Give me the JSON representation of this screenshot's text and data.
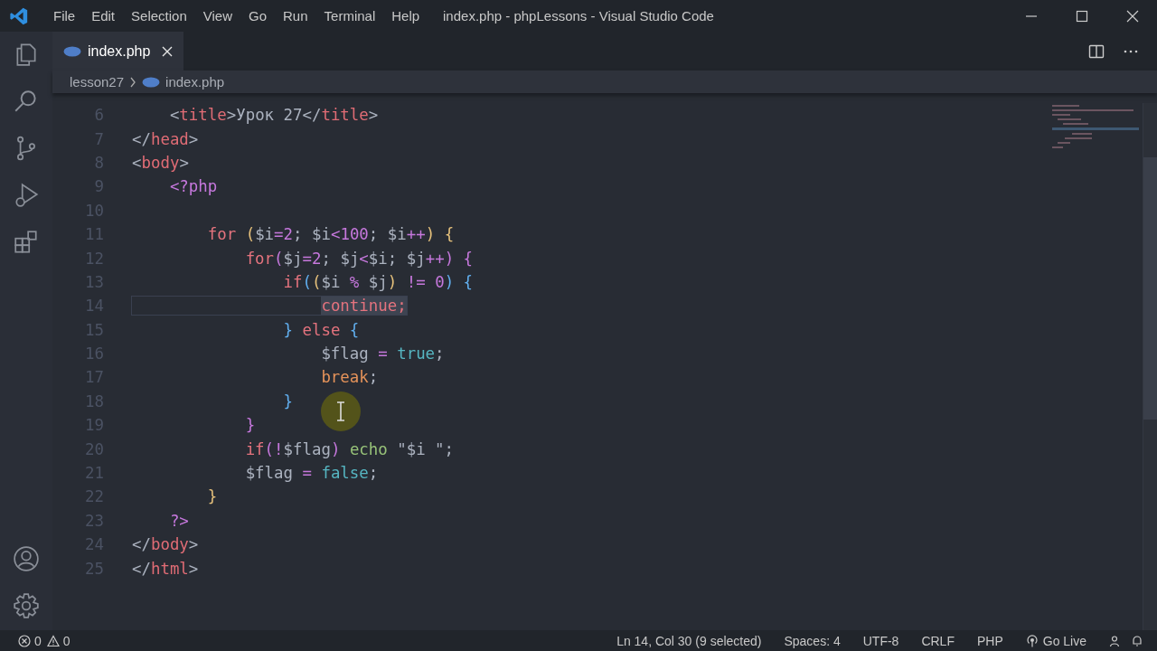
{
  "window": {
    "title": "index.php - phpLessons - Visual Studio Code"
  },
  "menu": [
    "File",
    "Edit",
    "Selection",
    "View",
    "Go",
    "Run",
    "Terminal",
    "Help"
  ],
  "activity_bar": [
    {
      "kind": "explorer",
      "selected": false
    },
    {
      "kind": "search",
      "selected": false
    },
    {
      "kind": "source-control",
      "selected": false
    },
    {
      "kind": "debug",
      "selected": false
    },
    {
      "kind": "extensions",
      "selected": false
    }
  ],
  "tabs": [
    {
      "label": "index.php",
      "selected": true
    }
  ],
  "breadcrumb": [
    "lesson27",
    "index.php"
  ],
  "editor": {
    "lines": [
      {
        "number": "6",
        "tokens": [
          {
            "t": "    <",
            "kind": "punct"
          },
          {
            "t": "title",
            "kind": "tag"
          },
          {
            "t": ">Урок 27</",
            "kind": "punct"
          },
          {
            "t": "title",
            "kind": "tag"
          },
          {
            "t": ">",
            "kind": "punct"
          }
        ]
      },
      {
        "number": "7",
        "tokens": [
          {
            "t": "</",
            "kind": "punct"
          },
          {
            "t": "head",
            "kind": "tag"
          },
          {
            "t": ">",
            "kind": "punct"
          }
        ]
      },
      {
        "number": "8",
        "tokens": [
          {
            "t": "<",
            "kind": "punct"
          },
          {
            "t": "body",
            "kind": "tag"
          },
          {
            "t": ">",
            "kind": "punct"
          }
        ]
      },
      {
        "number": "9",
        "tokens": [
          {
            "t": "    <?php",
            "kind": "php"
          }
        ]
      },
      {
        "number": "10"
      },
      {
        "number": "11",
        "tokens": [
          {
            "t": "        for",
            "kind": "kw"
          },
          {
            "t": " (",
            "kind": "p1"
          },
          {
            "t": "$i",
            "kind": "var"
          },
          {
            "t": "=",
            "kind": "op"
          },
          {
            "t": "2",
            "kind": "num"
          },
          {
            "t": "; $i",
            "kind": "var"
          },
          {
            "t": "<",
            "kind": "op"
          },
          {
            "t": "100",
            "kind": "num"
          },
          {
            "t": "; $i",
            "kind": "var"
          },
          {
            "t": "++",
            "kind": "op"
          },
          {
            "t": ")",
            "kind": "p1"
          },
          {
            "t": " {",
            "kind": "p1"
          }
        ]
      },
      {
        "number": "12",
        "tokens": [
          {
            "t": "            for",
            "kind": "kw"
          },
          {
            "t": "(",
            "kind": "p2"
          },
          {
            "t": "$j",
            "kind": "var"
          },
          {
            "t": "=",
            "kind": "op"
          },
          {
            "t": "2",
            "kind": "num"
          },
          {
            "t": "; $j",
            "kind": "var"
          },
          {
            "t": "<",
            "kind": "op"
          },
          {
            "t": "$i; $j",
            "kind": "var"
          },
          {
            "t": "++",
            "kind": "op"
          },
          {
            "t": ")",
            "kind": "p2"
          },
          {
            "t": " {",
            "kind": "p2"
          }
        ]
      },
      {
        "number": "13",
        "tokens": [
          {
            "t": "                if",
            "kind": "kw"
          },
          {
            "t": "(",
            "kind": "p3"
          },
          {
            "t": "(",
            "kind": "p1"
          },
          {
            "t": "$i ",
            "kind": "var"
          },
          {
            "t": "%",
            "kind": "op"
          },
          {
            "t": " $j",
            "kind": "var"
          },
          {
            "t": ")",
            "kind": "p1"
          },
          {
            "t": " != ",
            "kind": "op"
          },
          {
            "t": "0",
            "kind": "num"
          },
          {
            "t": ")",
            "kind": "p3"
          },
          {
            "t": " {",
            "kind": "p3"
          }
        ]
      },
      {
        "number": "14",
        "current": true,
        "tokens": [
          {
            "t": "                    continue;",
            "kind": "kw",
            "selected": true
          }
        ]
      },
      {
        "number": "15",
        "tokens": [
          {
            "t": "                }",
            "kind": "p3"
          },
          {
            "t": " else",
            "kind": "kw"
          },
          {
            "t": " {",
            "kind": "p3"
          }
        ]
      },
      {
        "number": "16",
        "tokens": [
          {
            "t": "                    $flag",
            "kind": "var"
          },
          {
            "t": " = ",
            "kind": "op"
          },
          {
            "t": "true",
            "kind": "bool"
          },
          {
            "t": ";",
            "kind": "punct"
          }
        ]
      },
      {
        "number": "17",
        "tokens": [
          {
            "t": "                    break",
            "kind": "brk"
          },
          {
            "t": ";",
            "kind": "punct"
          }
        ]
      },
      {
        "number": "18",
        "tokens": [
          {
            "t": "                }",
            "kind": "p3"
          }
        ]
      },
      {
        "number": "19",
        "tokens": [
          {
            "t": "            }",
            "kind": "p2"
          }
        ]
      },
      {
        "number": "20",
        "tokens": [
          {
            "t": "            if",
            "kind": "kw"
          },
          {
            "t": "(",
            "kind": "p2"
          },
          {
            "t": "!",
            "kind": "op"
          },
          {
            "t": "$flag",
            "kind": "var"
          },
          {
            "t": ")",
            "kind": "p2"
          },
          {
            "t": " echo",
            "kind": "fn"
          },
          {
            "t": " \"$i \";",
            "kind": "punct"
          }
        ]
      },
      {
        "number": "21",
        "tokens": [
          {
            "t": "            $flag",
            "kind": "var"
          },
          {
            "t": " = ",
            "kind": "op"
          },
          {
            "t": "false",
            "kind": "bool"
          },
          {
            "t": ";",
            "kind": "punct"
          }
        ]
      },
      {
        "number": "22",
        "tokens": [
          {
            "t": "        }",
            "kind": "p1"
          }
        ]
      },
      {
        "number": "23",
        "tokens": [
          {
            "t": "    ?>",
            "kind": "php"
          }
        ]
      },
      {
        "number": "24",
        "tokens": [
          {
            "t": "</",
            "kind": "punct"
          },
          {
            "t": "body",
            "kind": "tag"
          },
          {
            "t": ">",
            "kind": "punct"
          }
        ]
      },
      {
        "number": "25",
        "tokens": [
          {
            "t": "</",
            "kind": "punct"
          },
          {
            "t": "html",
            "kind": "tag"
          },
          {
            "t": ">",
            "kind": "punct"
          }
        ]
      }
    ]
  },
  "status_bar": {
    "errors": "0",
    "warnings": "0",
    "items": [
      "Ln 14, Col 30 (9 selected)",
      "Spaces: 4",
      "UTF-8",
      "CRLF",
      "PHP"
    ],
    "go_live": "Go Live"
  }
}
